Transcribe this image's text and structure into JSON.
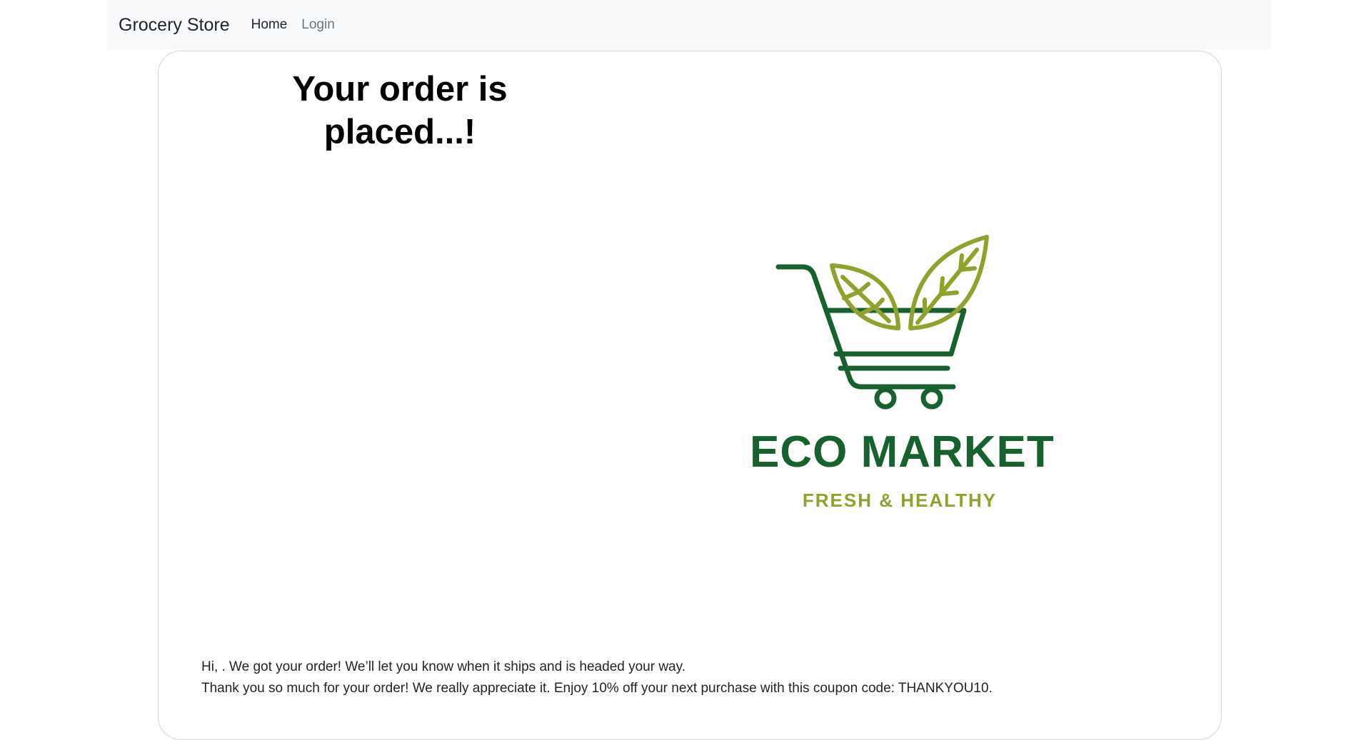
{
  "navbar": {
    "brand": "Grocery Store",
    "links": [
      {
        "label": "Home"
      },
      {
        "label": "Login"
      }
    ]
  },
  "main": {
    "heading": "Your order is placed...!",
    "logo": {
      "title": "ECO MARKET",
      "subtitle": "FRESH & HEALTHY",
      "icon": "shopping-cart-leaves-icon"
    },
    "message_line1": "Hi, . We got your order! We’ll let you know when it ships and is headed your way.",
    "message_line2": "Thank you so much for your order! We really appreciate it. Enjoy 10% off your next purchase with this coupon code: THANKYOU10."
  },
  "colors": {
    "navbar_bg": "#f8f9fa",
    "logo_dark_green": "#17612e",
    "logo_light_green": "#8fa32c"
  }
}
